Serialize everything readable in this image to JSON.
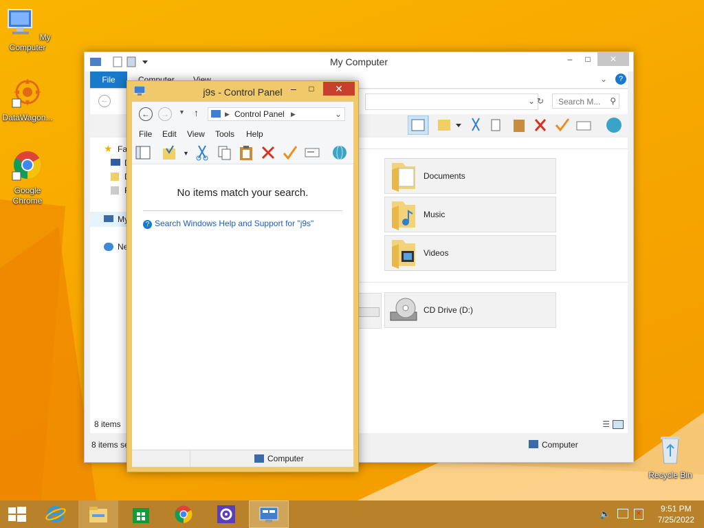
{
  "desktop": {
    "icons": [
      {
        "label": "My Computer"
      },
      {
        "label": "DataWagon..."
      },
      {
        "label": "Google Chrome"
      },
      {
        "label": "Recycle Bin"
      }
    ]
  },
  "my_computer_window": {
    "title": "My Computer",
    "ribbon_tabs": [
      "File",
      "Computer",
      "View"
    ],
    "search_placeholder": "Search M...",
    "nav_items": [
      "Fav",
      "D",
      "D",
      "R",
      "My",
      "Ne"
    ],
    "tiles": [
      {
        "label": "Documents",
        "icon": "documents-folder-icon"
      },
      {
        "label": "Music",
        "icon": "music-folder-icon"
      },
      {
        "label": "Videos",
        "icon": "videos-folder-icon"
      },
      {
        "label": "CD Drive (D:)",
        "icon": "cd-drive-icon"
      }
    ],
    "content_count": "8 items",
    "status_left": "8 items se",
    "status_right": "Computer"
  },
  "control_panel_window": {
    "title": "j9s - Control Panel",
    "address": "Control Panel",
    "menu": [
      "File",
      "Edit",
      "View",
      "Tools",
      "Help"
    ],
    "empty_message": "No items match your search.",
    "help_link": "Search Windows Help and Support for \"j9s\"",
    "status_right": "Computer"
  },
  "taskbar": {
    "time": "9:51 PM",
    "date": "7/25/2022"
  },
  "colors": {
    "desktop": "#f7a800",
    "taskbar": "#b8812a",
    "file_tab": "#1979ca",
    "close_button": "#c7402e",
    "cp_frame": "#f0c96a"
  }
}
